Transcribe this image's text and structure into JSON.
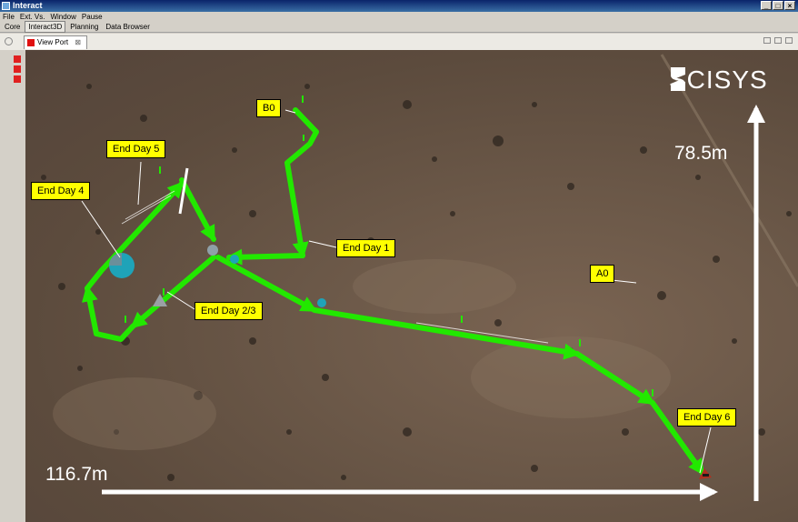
{
  "window": {
    "title": "Interact",
    "controls": [
      "_",
      "□",
      "×"
    ]
  },
  "menu": [
    "File",
    "Ext. Vs.",
    "Window",
    "Pause"
  ],
  "perspectives": [
    {
      "label": "Core",
      "active": false
    },
    {
      "label": "Interact3D",
      "active": true
    },
    {
      "label": "Planning",
      "active": false
    },
    {
      "label": "Data Browser",
      "active": false
    }
  ],
  "view_tab": {
    "label": "View Port",
    "close": "⊠"
  },
  "logo": {
    "text": "SCISYS"
  },
  "scale": {
    "horizontal": "116.7m",
    "vertical": "78.5m"
  },
  "waypoints": [
    "B0",
    "A0"
  ],
  "day_labels": [
    "End Day 5",
    "End Day 4",
    "End Day 1",
    "End Day 2/3",
    "End Day 6"
  ],
  "colors": {
    "route": "#22e800",
    "label_bg": "#ffff00",
    "scale_arrow": "#ffffff",
    "titlebar": "#0a246a"
  }
}
